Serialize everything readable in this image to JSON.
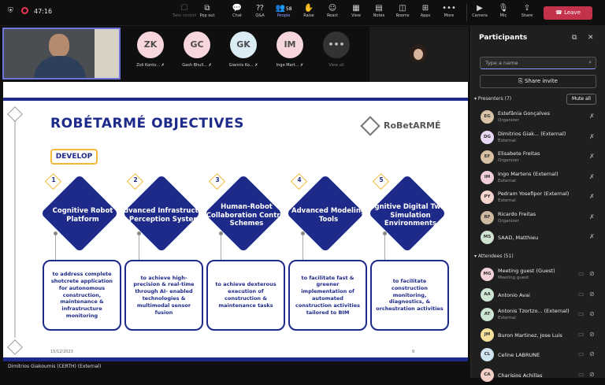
{
  "topbar": {
    "timer": "47:16",
    "buttons": [
      {
        "label": "Take control",
        "icon": "take-control-icon",
        "dim": true
      },
      {
        "label": "Pop out",
        "icon": "pop-out-icon"
      },
      {
        "label": "Chat",
        "icon": "chat-icon"
      },
      {
        "label": "Q&A",
        "icon": "qa-icon"
      },
      {
        "label": "People",
        "icon": "people-icon",
        "badge": "58",
        "active": true
      },
      {
        "label": "Raise",
        "icon": "raise-hand-icon"
      },
      {
        "label": "React",
        "icon": "react-icon"
      },
      {
        "label": "View",
        "icon": "view-icon"
      },
      {
        "label": "Notes",
        "icon": "notes-icon"
      },
      {
        "label": "Rooms",
        "icon": "rooms-icon"
      },
      {
        "label": "Apps",
        "icon": "apps-icon"
      },
      {
        "label": "More",
        "icon": "more-icon"
      },
      {
        "label": "Camera",
        "icon": "camera-icon"
      },
      {
        "label": "Mic",
        "icon": "mic-icon"
      },
      {
        "label": "Share",
        "icon": "share-icon"
      }
    ],
    "leave_label": "Leave"
  },
  "strip": {
    "tiles": [
      {
        "initials": "ZK",
        "name": "Zoli Konto..."
      },
      {
        "initials": "GC",
        "name": "Gash Bhull..."
      },
      {
        "initials": "GK",
        "name": "Giannis Ko..."
      },
      {
        "initials": "IM",
        "name": "Ingo Mart..."
      }
    ],
    "view_all": "View all"
  },
  "slide": {
    "title": "ROBÉTARMÉ OBJECTIVES",
    "logo": "RoBetARMÉ",
    "develop": "DEVELOP",
    "objectives": [
      {
        "num": "1",
        "title": "Cognitive Robot Platform",
        "desc": "to address complete shotcrete application for autonomous construction, maintenance & infrastructure monitoring"
      },
      {
        "num": "2",
        "title": "Advanced Infrastructure Perception System",
        "desc": "to achieve high-precision & real-time through AI- enabled technologies & multimodal sensor fusion"
      },
      {
        "num": "3",
        "title": "Human-Robot Collaboration Control Schemes",
        "desc": "to achieve dexterous execution of construction & maintenance tasks"
      },
      {
        "num": "4",
        "title": "Advanced Modeling Tools",
        "desc": "to facilitate fast & greener implementation of automated construction activities tailored to BIM"
      },
      {
        "num": "5",
        "title": "Cognitive Digital Twin & Simulation Environments",
        "desc": "to facilitate construction monitoring, diagnostics, & orchestration activities"
      }
    ],
    "date": "15/12/2023",
    "page": "9"
  },
  "caption": "Dimitrios Giakoumis (CERTH) (External)",
  "panel": {
    "title": "Participants",
    "search_placeholder": "Type a name",
    "share_invite": "Share invite",
    "presenters_label": "Presenters (7)",
    "mute_all": "Mute all",
    "presenters": [
      {
        "initials": "EG",
        "name": "Estefânia Gonçalves",
        "role": "Organizer",
        "color": "#d9c2a6"
      },
      {
        "initials": "DG",
        "name": "Dimitrios Giak...  (External)",
        "role": "External",
        "color": "#e8d8f5"
      },
      {
        "initials": "EF",
        "name": "Elisabete Freitas",
        "role": "Organizer",
        "color": "#d8c0a4"
      },
      {
        "initials": "IM",
        "name": "Ingo Martens (External)",
        "role": "External",
        "color": "#f0cfd8"
      },
      {
        "initials": "PY",
        "name": "Pedram Yosefipor (External)",
        "role": "External",
        "color": "#f5d6cf"
      },
      {
        "initials": "RF",
        "name": "Ricardo Freitas",
        "role": "Organizer",
        "color": "#cfb9a0"
      },
      {
        "initials": "MS",
        "name": "SAAD, Matthieu",
        "role": "",
        "color": "#cfe3d2"
      }
    ],
    "attendees_label": "Attendees (51)",
    "attendees": [
      {
        "initials": "MG",
        "name": "Meeting guest (Guest)",
        "role": "Meeting guest",
        "color": "#f2d2d8"
      },
      {
        "initials": "AA",
        "name": "Antonio Avai",
        "role": "",
        "color": "#cde6d4"
      },
      {
        "initials": "AT",
        "name": "Antonis Tzortzo... (External)",
        "role": "External",
        "color": "#cde6d4"
      },
      {
        "initials": "JM",
        "name": "Buron Martinez, Jose Luis",
        "role": "",
        "color": "#f5e19c"
      },
      {
        "initials": "CL",
        "name": "Celine LABRUNE",
        "role": "",
        "color": "#cfe3f0"
      },
      {
        "initials": "CA",
        "name": "Charisios Achillas",
        "role": "",
        "color": "#f3cfc8"
      }
    ]
  }
}
